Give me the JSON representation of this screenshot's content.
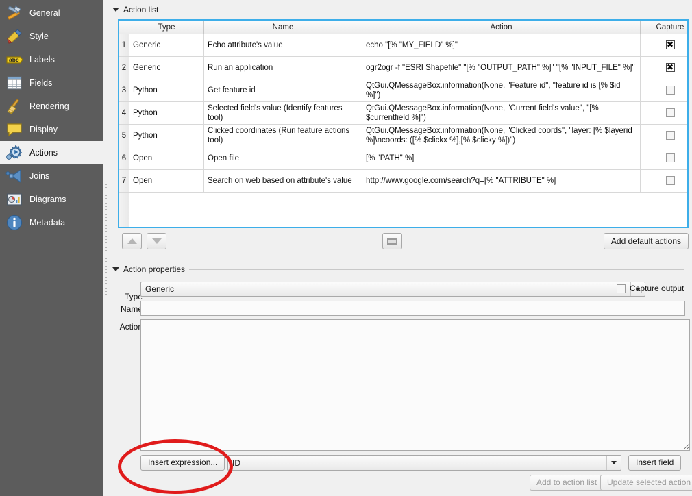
{
  "sidebar": {
    "items": [
      {
        "label": "General",
        "icon": "hammer-icon",
        "selected": false
      },
      {
        "label": "Style",
        "icon": "brush-icon",
        "selected": false
      },
      {
        "label": "Labels",
        "icon": "abc-icon",
        "selected": false
      },
      {
        "label": "Fields",
        "icon": "table-icon",
        "selected": false
      },
      {
        "label": "Rendering",
        "icon": "broom-icon",
        "selected": false
      },
      {
        "label": "Display",
        "icon": "speech-bubble-icon",
        "selected": false
      },
      {
        "label": "Actions",
        "icon": "gear-play-icon",
        "selected": true
      },
      {
        "label": "Joins",
        "icon": "join-arrow-icon",
        "selected": false
      },
      {
        "label": "Diagrams",
        "icon": "chart-icon",
        "selected": false
      },
      {
        "label": "Metadata",
        "icon": "info-icon",
        "selected": false
      }
    ]
  },
  "action_list": {
    "title": "Action list",
    "columns": [
      "Type",
      "Name",
      "Action",
      "Capture"
    ],
    "rows": [
      {
        "index": "1",
        "type": "Generic",
        "name": "Echo attribute's value",
        "action": "echo \"[% \"MY_FIELD\" %]\"",
        "capture": true
      },
      {
        "index": "2",
        "type": "Generic",
        "name": "Run an application",
        "action": "ogr2ogr -f \"ESRI Shapefile\" \"[% \"OUTPUT_PATH\" %]\" \"[% \"INPUT_FILE\" %]\"",
        "capture": true
      },
      {
        "index": "3",
        "type": "Python",
        "name": "Get feature id",
        "action": "QtGui.QMessageBox.information(None, \"Feature id\", \"feature id is [% $id %]\")",
        "capture": false
      },
      {
        "index": "4",
        "type": "Python",
        "name": "Selected field's value (Identify features tool)",
        "action": "QtGui.QMessageBox.information(None, \"Current field's value\", \"[% $currentfield %]\")",
        "capture": false
      },
      {
        "index": "5",
        "type": "Python",
        "name": "Clicked coordinates (Run feature actions tool)",
        "action": "QtGui.QMessageBox.information(None, \"Clicked coords\", \"layer: [% $layerid %]\\ncoords: ([% $clickx %],[% $clicky %])\")",
        "capture": false
      },
      {
        "index": "6",
        "type": "Open",
        "name": "Open file",
        "action": "[% \"PATH\" %]",
        "capture": false
      },
      {
        "index": "7",
        "type": "Open",
        "name": "Search on web based on attribute's value",
        "action": "http://www.google.com/search?q=[% \"ATTRIBUTE\" %]",
        "capture": false
      }
    ],
    "toolbar": {
      "move_up": "move-up-icon",
      "move_down": "move-down-icon",
      "edit": "edit-icon",
      "add_defaults_label": "Add default actions"
    }
  },
  "action_properties": {
    "title": "Action properties",
    "type_label": "Type",
    "type_value": "Generic",
    "capture_output_label": "Capture output",
    "capture_output_checked": false,
    "name_label": "Name",
    "name_value": "",
    "name_placeholder": "",
    "action_label": "Action",
    "action_value": "",
    "browse_icon": "folder-icon",
    "insert_expression_label": "Insert expression...",
    "field_value": "ID",
    "insert_field_label": "Insert field",
    "add_to_action_list_label": "Add to action list",
    "update_selected_action_label": "Update selected action"
  },
  "annotation": {
    "shape": "ellipse",
    "color": "#e01b1b",
    "target": "Insert expression... button"
  },
  "colors": {
    "sidebar_bg": "#5c5c5c",
    "sidebar_selected_bg": "#f0f0f0",
    "panel_bg": "#f0f0f0",
    "focus_border": "#3daee9",
    "annotation_red": "#e01b1b"
  }
}
